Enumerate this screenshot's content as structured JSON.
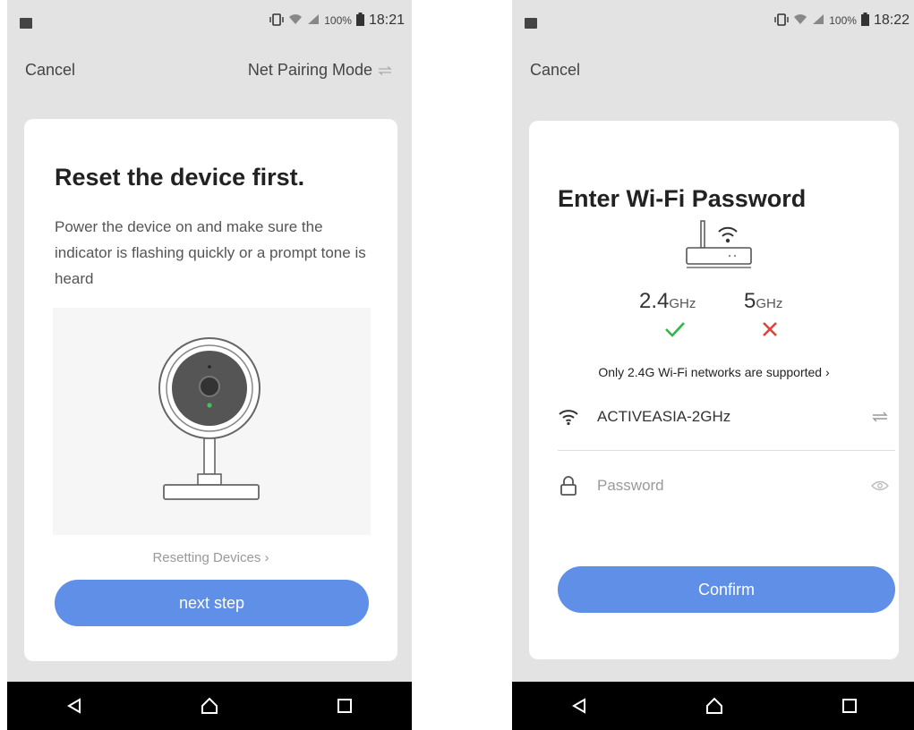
{
  "left_screen": {
    "status": {
      "battery": "100%",
      "time": "18:21"
    },
    "topbar": {
      "cancel_label": "Cancel",
      "mode_label": "Net Pairing Mode",
      "mode_icon": "swap-icon"
    },
    "card": {
      "title": "Reset the device first.",
      "description": "Power the device on and make sure the indicator is flashing quickly or a prompt tone is heard",
      "illustration_icon": "camera-icon",
      "link_label": "Resetting Devices",
      "button_label": "next step"
    }
  },
  "right_screen": {
    "status": {
      "battery": "100%",
      "time": "18:22"
    },
    "topbar": {
      "cancel_label": "Cancel"
    },
    "card": {
      "title": "Enter Wi-Fi Password",
      "illustration_icon": "router-icon",
      "freq_24": {
        "value": "2.4",
        "unit": "GHz",
        "status_icon": "check-icon"
      },
      "freq_5": {
        "value": "5",
        "unit": "GHz",
        "status_icon": "cross-icon"
      },
      "support_note": "Only 2.4G Wi-Fi networks are supported",
      "wifi_name": "ACTIVEASIA-2GHz",
      "password_placeholder": "Password",
      "button_label": "Confirm"
    }
  },
  "colors": {
    "accent": "#5f8fe6",
    "check": "#2fb84a",
    "cross": "#e0413a",
    "background": "#e3e3e3"
  }
}
